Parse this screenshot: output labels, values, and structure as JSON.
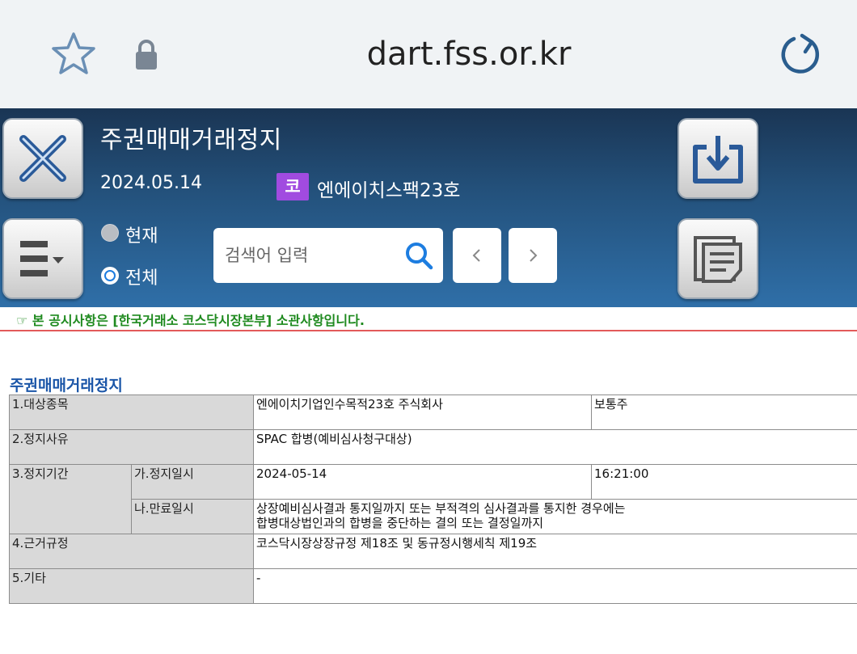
{
  "browser": {
    "url": "dart.fss.or.kr",
    "icons": {
      "bookmark": "star-icon",
      "secure": "lock-icon",
      "reload": "reload-icon"
    }
  },
  "header": {
    "title": "주권매매거래정지",
    "date": "2024.05.14",
    "market_badge": "코",
    "company": "엔에이치스팩23호",
    "radio_current": "현재",
    "radio_all": "전체",
    "selected_radio": "전체",
    "search_placeholder": "검색어 입력",
    "colors": {
      "badge": "#a14be0",
      "header_top": "#1a3554",
      "header_bottom": "#2f6fa8"
    }
  },
  "notice": {
    "text": "☞ 본 공시사항은 [한국거래소 코스닥시장본부] 소관사항입니다."
  },
  "content": {
    "section_title": "주권매매거래정지",
    "rows": {
      "target_label": "1.대상종목",
      "target_name": "엔에이치기업인수목적23호 주식회사",
      "target_type": "보통주",
      "reason_label": "2.정지사유",
      "reason_value": "SPAC 합병(예비심사청구대상)",
      "period_label": "3.정지기간",
      "start_label": "가.정지일시",
      "start_date": "2024-05-14",
      "start_time": "16:21:00",
      "end_label": "나.만료일시",
      "end_value_line1": "상장예비심사결과 통지일까지 또는 부적격의 심사결과를 통지한 경우에는",
      "end_value_line2": "합병대상법인과의 합병을 중단하는 결의 또는 결정일까지",
      "basis_label": "4.근거규정",
      "basis_value": "코스닥시장상장규정 제18조 및 동규정시행세칙 제19조",
      "other_label": "5.기타",
      "other_value": "-"
    }
  }
}
